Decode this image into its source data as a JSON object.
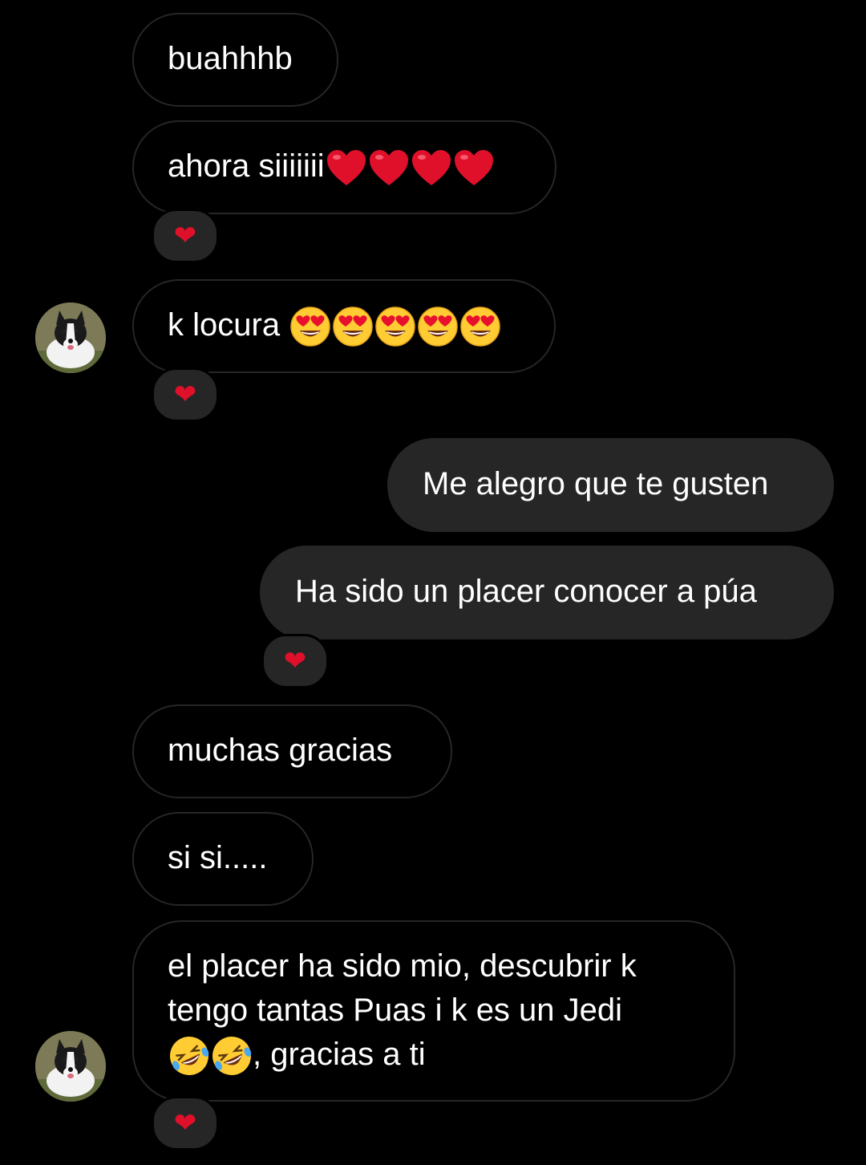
{
  "messages": [
    {
      "id": "m1",
      "direction": "incoming",
      "text": "buahhhb",
      "reaction": null
    },
    {
      "id": "m2",
      "direction": "incoming",
      "text": "ahora siiiiiii",
      "emoji": "red-heart",
      "emoji_count": 4,
      "reaction": "❤"
    },
    {
      "id": "m3",
      "direction": "incoming",
      "text": "k locura ",
      "emoji": "heart-eyes-face",
      "emoji_count": 5,
      "reaction": "❤",
      "avatar": "dog-avatar"
    },
    {
      "id": "m4",
      "direction": "outgoing",
      "text": "Me alegro que te gusten",
      "reaction": null
    },
    {
      "id": "m5",
      "direction": "outgoing",
      "text": "Ha sido un placer conocer a púa",
      "reaction": "❤"
    },
    {
      "id": "m6",
      "direction": "incoming",
      "text": "muchas gracias",
      "reaction": null
    },
    {
      "id": "m7",
      "direction": "incoming",
      "text": "si si.....",
      "reaction": null
    },
    {
      "id": "m8",
      "direction": "incoming",
      "text_line1": "el placer ha sido mio, descubrir k",
      "text_line2": "tengo tantas Puas i k es un Jedi",
      "text_line3": ", gracias a ti",
      "emoji": "rolling-laughing-face",
      "emoji_count": 2,
      "reaction": "❤",
      "avatar": "dog-avatar"
    }
  ],
  "colors": {
    "background": "#000000",
    "outgoing_bubble": "#262626",
    "incoming_border": "#262626",
    "reaction_bg": "#262626",
    "heart": "#e0102b",
    "text": "#ffffff"
  }
}
